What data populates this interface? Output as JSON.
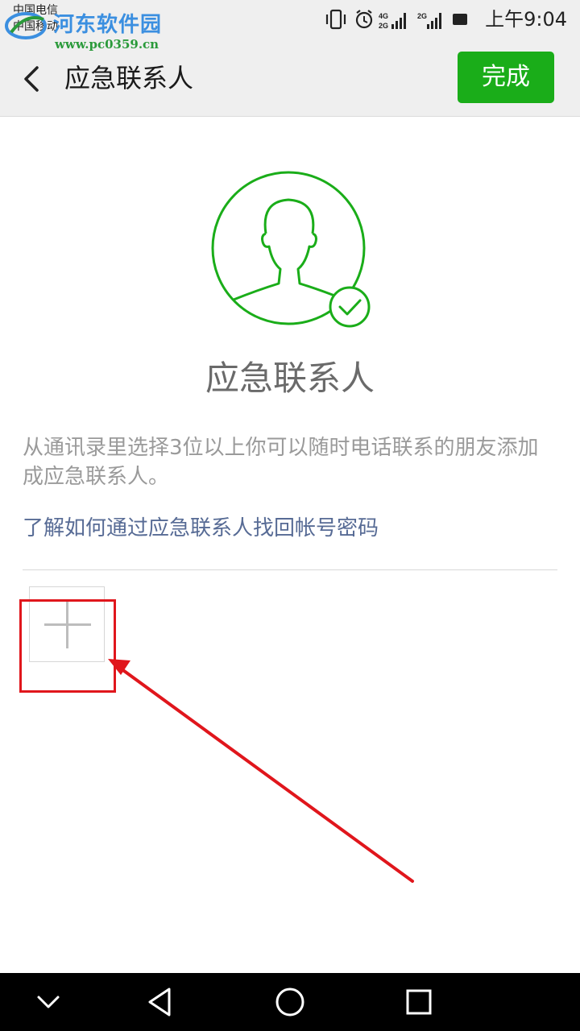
{
  "status_bar": {
    "carrier_1": "中国电信",
    "carrier_2": "中国移动",
    "signal_1_label": "4G 2G",
    "signal_2_label": "2G",
    "time": "上午9:04"
  },
  "watermark": {
    "title": "河东软件园",
    "url": "www.pc0359.cn"
  },
  "title_bar": {
    "title": "应急联系人",
    "done_label": "完成"
  },
  "content": {
    "heading": "应急联系人",
    "description": "从通讯录里选择3位以上你可以随时电话联系的朋友添加成应急联系人。",
    "help_link": "了解如何通过应急联系人找回帐号密码"
  },
  "icons": {
    "back": "back-chevron-icon",
    "avatar": "person-avatar-icon",
    "check": "check-badge-icon",
    "add": "plus-icon",
    "nav_down": "chevron-down-icon",
    "nav_back": "triangle-back-icon",
    "nav_home": "circle-home-icon",
    "nav_recents": "square-recents-icon"
  },
  "colors": {
    "accent_green": "#1aad19",
    "link_blue": "#576b95",
    "annotation_red": "#e0161c"
  }
}
